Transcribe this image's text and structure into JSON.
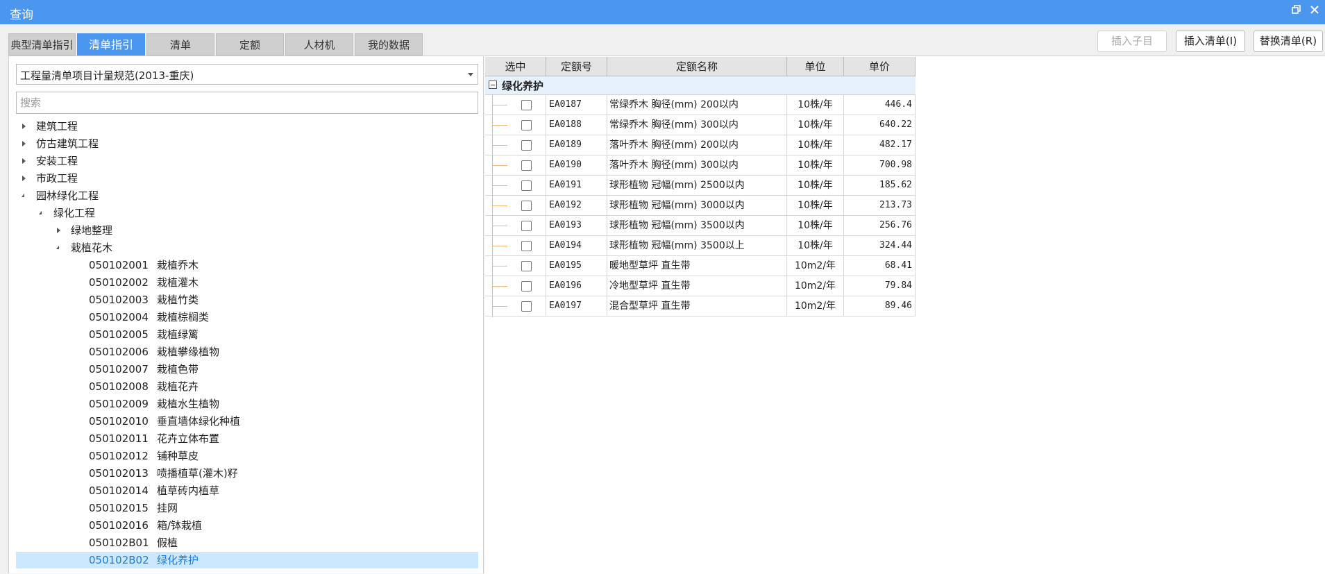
{
  "window": {
    "title": "查询",
    "restore_icon": "restore-icon",
    "close_icon": "close-icon"
  },
  "tabs": [
    {
      "label": "典型清单指引",
      "active": false
    },
    {
      "label": "清单指引",
      "active": true
    },
    {
      "label": "清单",
      "active": false
    },
    {
      "label": "定额",
      "active": false
    },
    {
      "label": "人材机",
      "active": false
    },
    {
      "label": "我的数据",
      "active": false
    }
  ],
  "toolbar": {
    "insert_child": "插入子目",
    "insert_list": "插入清单(I)",
    "replace_list": "替换清单(R)"
  },
  "left": {
    "spec_select": "工程量清单项目计量规范(2013-重庆)",
    "search_placeholder": "搜索",
    "tree": [
      {
        "label": "建筑工程",
        "level": 0,
        "state": "collapsed"
      },
      {
        "label": "仿古建筑工程",
        "level": 0,
        "state": "collapsed"
      },
      {
        "label": "安装工程",
        "level": 0,
        "state": "collapsed"
      },
      {
        "label": "市政工程",
        "level": 0,
        "state": "collapsed"
      },
      {
        "label": "园林绿化工程",
        "level": 0,
        "state": "expanded"
      },
      {
        "label": "绿化工程",
        "level": 1,
        "state": "expanded"
      },
      {
        "label": "绿地整理",
        "level": 2,
        "state": "collapsed"
      },
      {
        "label": "栽植花木",
        "level": 2,
        "state": "expanded"
      },
      {
        "code": "050102001",
        "label": "栽植乔木",
        "level": 3
      },
      {
        "code": "050102002",
        "label": "栽植灌木",
        "level": 3
      },
      {
        "code": "050102003",
        "label": "栽植竹类",
        "level": 3
      },
      {
        "code": "050102004",
        "label": "栽植棕榈类",
        "level": 3
      },
      {
        "code": "050102005",
        "label": "栽植绿篱",
        "level": 3
      },
      {
        "code": "050102006",
        "label": "栽植攀缘植物",
        "level": 3
      },
      {
        "code": "050102007",
        "label": "栽植色带",
        "level": 3
      },
      {
        "code": "050102008",
        "label": "栽植花卉",
        "level": 3
      },
      {
        "code": "050102009",
        "label": "栽植水生植物",
        "level": 3
      },
      {
        "code": "050102010",
        "label": "垂直墙体绿化种植",
        "level": 3
      },
      {
        "code": "050102011",
        "label": "花卉立体布置",
        "level": 3
      },
      {
        "code": "050102012",
        "label": "铺种草皮",
        "level": 3
      },
      {
        "code": "050102013",
        "label": "喷播植草(灌木)籽",
        "level": 3
      },
      {
        "code": "050102014",
        "label": "植草砖内植草",
        "level": 3
      },
      {
        "code": "050102015",
        "label": "挂网",
        "level": 3
      },
      {
        "code": "050102016",
        "label": "箱/钵栽植",
        "level": 3
      },
      {
        "code": "050102B01",
        "label": "假植",
        "level": 3
      },
      {
        "code": "050102B02",
        "label": "绿化养护",
        "level": 3,
        "selected": true
      }
    ]
  },
  "table": {
    "headers": [
      "选中",
      "定额号",
      "定额名称",
      "单位",
      "单价"
    ],
    "group": "绿化养护",
    "rows": [
      {
        "code": "EA0187",
        "name": "常绿乔木 胸径(mm) 200以内",
        "unit": "10株/年",
        "price": "446.4"
      },
      {
        "code": "EA0188",
        "name": "常绿乔木 胸径(mm) 300以内",
        "unit": "10株/年",
        "price": "640.22"
      },
      {
        "code": "EA0189",
        "name": "落叶乔木 胸径(mm) 200以内",
        "unit": "10株/年",
        "price": "482.17"
      },
      {
        "code": "EA0190",
        "name": "落叶乔木 胸径(mm) 300以内",
        "unit": "10株/年",
        "price": "700.98"
      },
      {
        "code": "EA0191",
        "name": "球形植物 冠幅(mm) 2500以内",
        "unit": "10株/年",
        "price": "185.62"
      },
      {
        "code": "EA0192",
        "name": "球形植物 冠幅(mm) 3000以内",
        "unit": "10株/年",
        "price": "213.73"
      },
      {
        "code": "EA0193",
        "name": "球形植物 冠幅(mm) 3500以内",
        "unit": "10株/年",
        "price": "256.76"
      },
      {
        "code": "EA0194",
        "name": "球形植物 冠幅(mm) 3500以上",
        "unit": "10株/年",
        "price": "324.44"
      },
      {
        "code": "EA0195",
        "name": "暖地型草坪 直生带",
        "unit": "10m2/年",
        "price": "68.41"
      },
      {
        "code": "EA0196",
        "name": "冷地型草坪 直生带",
        "unit": "10m2/年",
        "price": "79.84"
      },
      {
        "code": "EA0197",
        "name": "混合型草坪 直生带",
        "unit": "10m2/年",
        "price": "89.46"
      }
    ]
  },
  "colors": {
    "accent": "#4b97f0",
    "selected_row_bg": "#cce8ff",
    "selected_row_text": "#1e7ad6",
    "group_bg": "#e6f1fb"
  }
}
